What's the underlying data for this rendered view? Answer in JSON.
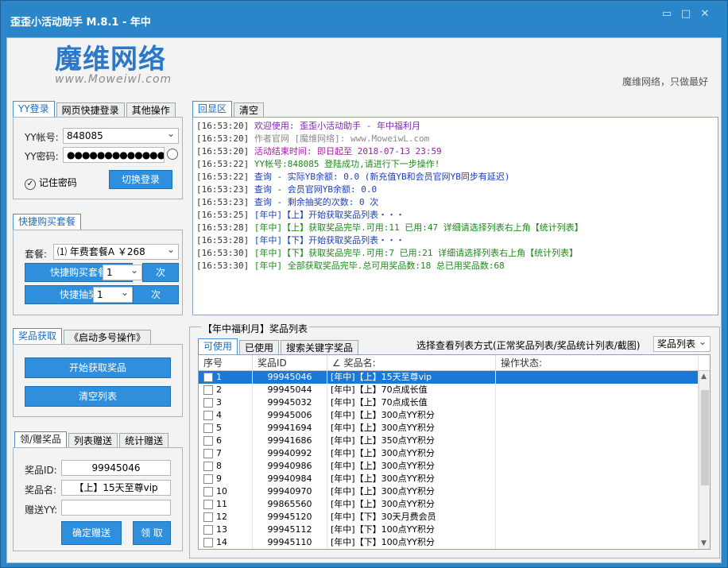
{
  "window": {
    "title": "歪歪小活动助手 M.8.1 - 年中"
  },
  "header": {
    "logo_text": "魔维网络",
    "logo_url": "www.Moweiwl.com",
    "slogan": "魔维网络，只做最好"
  },
  "login": {
    "tabs": [
      "YY登录",
      "网页快捷登录",
      "其他操作"
    ],
    "account_label": "YY帐号:",
    "account_value": "848085",
    "password_label": "YY密码:",
    "password_value": "●●●●●●●●●●●●●●",
    "remember_label": "记住密码",
    "switch_button": "切换登录"
  },
  "purchase": {
    "tab": "快捷购买套餐",
    "package_label": "套餐:",
    "package_value": "⑴ 年费套餐A  ￥268",
    "quick_buy_button": "快捷购买套餐",
    "quick_buy_qty": "1",
    "times_label_1": "次",
    "quick_draw_button": "快捷抽奖",
    "quick_draw_qty": "1",
    "times_label_2": "次"
  },
  "prize": {
    "tabs": [
      "奖品获取",
      "《启动多号操作》"
    ],
    "start_button": "开始获取奖品",
    "clear_button": "清空列表"
  },
  "gift": {
    "tabs": [
      "领/赠奖品",
      "列表赠送",
      "统计赠送"
    ],
    "id_label": "奖品ID:",
    "id_value": "99945046",
    "name_label": "奖品名:",
    "name_value": "【上】15天至尊vip",
    "to_label": "赠送YY:",
    "to_value": "",
    "confirm_button": "确定赠送",
    "claim_button": "领 取"
  },
  "log": {
    "tabs": [
      "回显区",
      "清空"
    ],
    "lines": [
      {
        "ts": "[16:53:20]",
        "text": "欢迎使用: 歪歪小活动助手 - 年中福利月",
        "color": "#7a2aa8"
      },
      {
        "ts": "[16:53:20]",
        "text": "作者官网 [魔维网络]: www.MoweiwL.com",
        "color": "#8a8a8a"
      },
      {
        "ts": "[16:53:20]",
        "text": "活动结束时间: 即日起至 2018-07-13 23:59",
        "color": "#a020a0"
      },
      {
        "ts": "[16:53:22]",
        "text": "YY帐号:848085 登陆成功,请进行下一步操作!",
        "color": "#1a8a1a"
      },
      {
        "ts": "[16:53:22]",
        "text": "查询 - 实际YB余额: 0.0 (新充值YB和会员官网YB同步有延迟)",
        "color": "#1c3fb0"
      },
      {
        "ts": "[16:53:23]",
        "text": "查询 - 会员官网YB余额: 0.0",
        "color": "#1c3fb0"
      },
      {
        "ts": "[16:53:23]",
        "text": "查询 - 剩余抽奖的次数: 0 次",
        "color": "#1c3fb0"
      },
      {
        "ts": "[16:53:25]",
        "text": "[年中]【上】开始获取奖品列表・・・",
        "color": "#1c3fb0"
      },
      {
        "ts": "[16:53:28]",
        "text": "[年中]【上】获取奖品完毕.可用:11 已用:47 详细请选择列表右上角【统计列表】",
        "color": "#1a8a1a"
      },
      {
        "ts": "[16:53:28]",
        "text": "[年中]【下】开始获取奖品列表・・・",
        "color": "#1c3fb0"
      },
      {
        "ts": "[16:53:30]",
        "text": "[年中]【下】获取奖品完毕.可用:7 已用:21 详细请选择列表右上角【统计列表】",
        "color": "#1a8a1a"
      },
      {
        "ts": "[16:53:30]",
        "text": "[年中] 全部获取奖品完毕.总可用奖品数:18 总已用奖品数:68",
        "color": "#1a8a1a"
      }
    ]
  },
  "list": {
    "group_title": "【年中福利月】奖品列表",
    "tabs": [
      "可使用",
      "已使用",
      "搜索关键字奖品"
    ],
    "view_label": "选择查看列表方式(正常奖品列表/奖品统计列表/截图)",
    "view_value": "奖品列表",
    "columns": [
      "序号",
      "奖品ID",
      "∠ 奖品名:",
      "操作状态:"
    ],
    "rows": [
      {
        "no": "1",
        "id": "99945046",
        "name": "[年中]【上】15天至尊vip",
        "status": ""
      },
      {
        "no": "2",
        "id": "99945044",
        "name": "[年中]【上】70点成长值",
        "status": ""
      },
      {
        "no": "3",
        "id": "99945032",
        "name": "[年中]【上】70点成长值",
        "status": ""
      },
      {
        "no": "4",
        "id": "99945006",
        "name": "[年中]【上】300点YY积分",
        "status": ""
      },
      {
        "no": "5",
        "id": "99941694",
        "name": "[年中]【上】300点YY积分",
        "status": ""
      },
      {
        "no": "6",
        "id": "99941686",
        "name": "[年中]【上】350点YY积分",
        "status": ""
      },
      {
        "no": "7",
        "id": "99940992",
        "name": "[年中]【上】300点YY积分",
        "status": ""
      },
      {
        "no": "8",
        "id": "99940986",
        "name": "[年中]【上】300点YY积分",
        "status": ""
      },
      {
        "no": "9",
        "id": "99940984",
        "name": "[年中]【上】300点YY积分",
        "status": ""
      },
      {
        "no": "10",
        "id": "99940970",
        "name": "[年中]【上】300点YY积分",
        "status": ""
      },
      {
        "no": "11",
        "id": "99865560",
        "name": "[年中]【上】300点YY积分",
        "status": ""
      },
      {
        "no": "12",
        "id": "99945120",
        "name": "[年中]【下】30天月费会员",
        "status": ""
      },
      {
        "no": "13",
        "id": "99945112",
        "name": "[年中]【下】100点YY积分",
        "status": ""
      },
      {
        "no": "14",
        "id": "99945110",
        "name": "[年中]【下】100点YY积分",
        "status": ""
      }
    ],
    "selected_index": 0
  }
}
